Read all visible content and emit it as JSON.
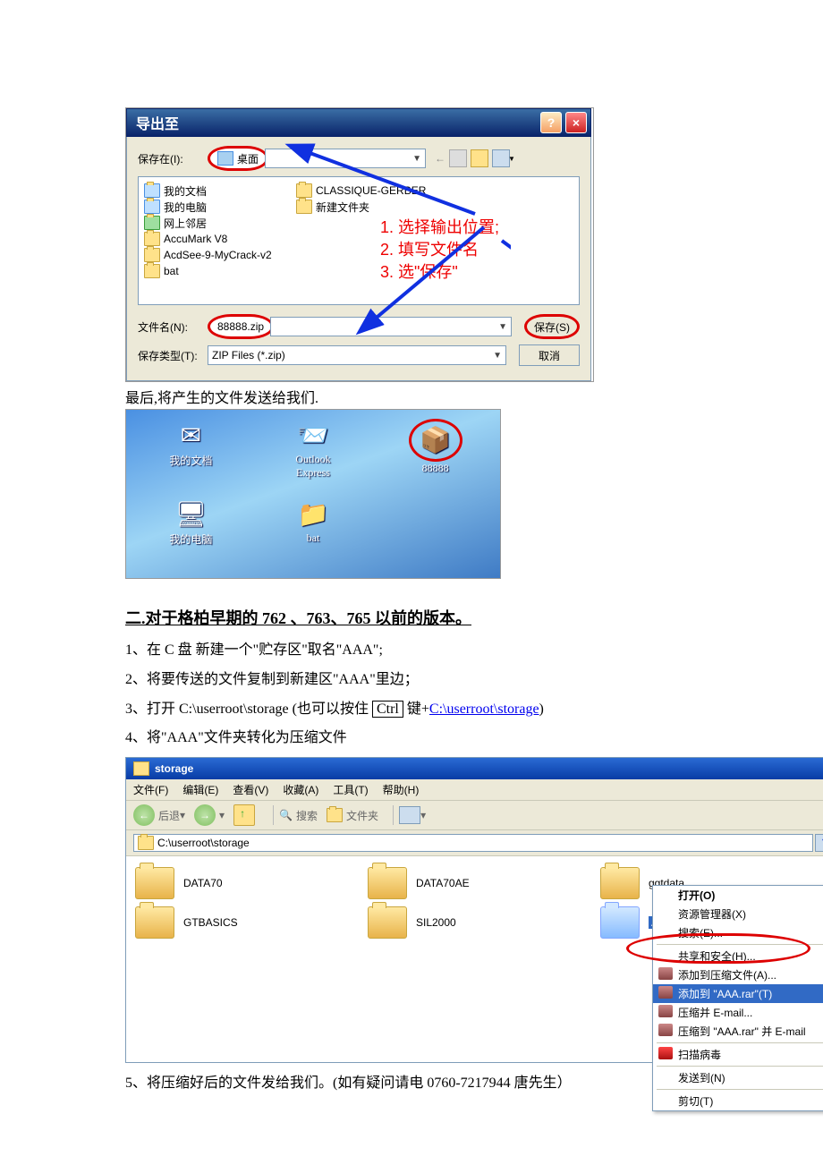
{
  "export_dialog": {
    "title": "导出至",
    "save_in_label": "保存在(I):",
    "save_in_value": "桌面",
    "nav_icons": [
      "back-icon",
      "desktop-icon",
      "newfolder-icon",
      "viewmenu-icon"
    ],
    "file_list_left": [
      {
        "icon": "my-documents-icon",
        "label": "我的文档"
      },
      {
        "icon": "my-computer-icon",
        "label": "我的电脑"
      },
      {
        "icon": "network-icon",
        "label": "网上邻居"
      },
      {
        "icon": "folder-icon",
        "label": "AccuMark V8"
      },
      {
        "icon": "folder-icon",
        "label": "AcdSee-9-MyCrack-v2"
      },
      {
        "icon": "folder-icon",
        "label": "bat"
      }
    ],
    "file_list_right": [
      {
        "icon": "folder-icon",
        "label": "CLASSIQUE-GERBER"
      },
      {
        "icon": "folder-icon",
        "label": "新建文件夹"
      }
    ],
    "annotations": [
      "1. 选择输出位置;",
      "2. 填写文件名",
      "3. 选\"保存\""
    ],
    "filename_label": "文件名(N):",
    "filename_value": "88888.zip",
    "filetype_label": "保存类型(T):",
    "filetype_value": "ZIP Files (*.zip)",
    "save_btn": "保存(S)",
    "cancel_btn": "取消"
  },
  "caption_1": "最后,将产生的文件发送给我们.",
  "desktop_icons": [
    {
      "id": "my-documents",
      "label": "我的文档",
      "glyph": "✉"
    },
    {
      "id": "outlook-express",
      "label": "Outlook Express",
      "glyph": "📨"
    },
    {
      "id": "archive-88888",
      "label": "88888",
      "glyph": "📦",
      "circle": true
    },
    {
      "id": "my-computer",
      "label": "我的电脑",
      "glyph": "🖥"
    },
    {
      "id": "bat-folder",
      "label": "bat",
      "glyph": "📁"
    }
  ],
  "section_title": "二.对于格柏早期的 762 、763、765 以前的版本。",
  "steps": {
    "s1": "1、在 C 盘 新建一个\"贮存区\"取名\"AAA\";",
    "s2": "2、将要传送的文件复制到新建区\"AAA\"里边；",
    "s3_pre": "3、打开 C:\\userroot\\storage (也可以按住 ",
    "s3_ctrl": "Ctrl",
    "s3_mid": " 键+",
    "s3_link": "C:\\userroot\\storage",
    "s3_post": ")",
    "s4": "4、将\"AAA\"文件夹转化为压缩文件"
  },
  "explorer": {
    "title": "storage",
    "menu": [
      "文件(F)",
      "编辑(E)",
      "查看(V)",
      "收藏(A)",
      "工具(T)",
      "帮助(H)"
    ],
    "back_label": "后退",
    "search_label": "搜索",
    "folders_label": "文件夹",
    "address": "C:\\userroot\\storage",
    "items": [
      "DATA70",
      "DATA70AE",
      "ggtdata",
      "GTBASICS",
      "SIL2000"
    ],
    "selected_item": "AAAA",
    "context_menu": [
      {
        "label": "打开(O)",
        "bold": true
      },
      {
        "label": "资源管理器(X)"
      },
      {
        "label": "搜索(E)..."
      },
      {
        "sep": true
      },
      {
        "label": "共享和安全(H)..."
      },
      {
        "label": "添加到压缩文件(A)...",
        "icon": "arc"
      },
      {
        "label": "添加到 \"AAA.rar\"(T)",
        "icon": "arc",
        "sel": true
      },
      {
        "label": "压缩并 E-mail...",
        "icon": "arc"
      },
      {
        "label": "压缩到 \"AAA.rar\" 并 E-mail",
        "icon": "arc"
      },
      {
        "sep": true
      },
      {
        "label": "扫描病毒",
        "icon": "scan"
      },
      {
        "sep": true
      },
      {
        "label": "发送到(N)"
      },
      {
        "sep": true
      },
      {
        "label": "剪切(T)"
      }
    ]
  },
  "caption_final": "5、将压缩好后的文件发给我们。(如有疑问请电 0760-7217944 唐先生）"
}
